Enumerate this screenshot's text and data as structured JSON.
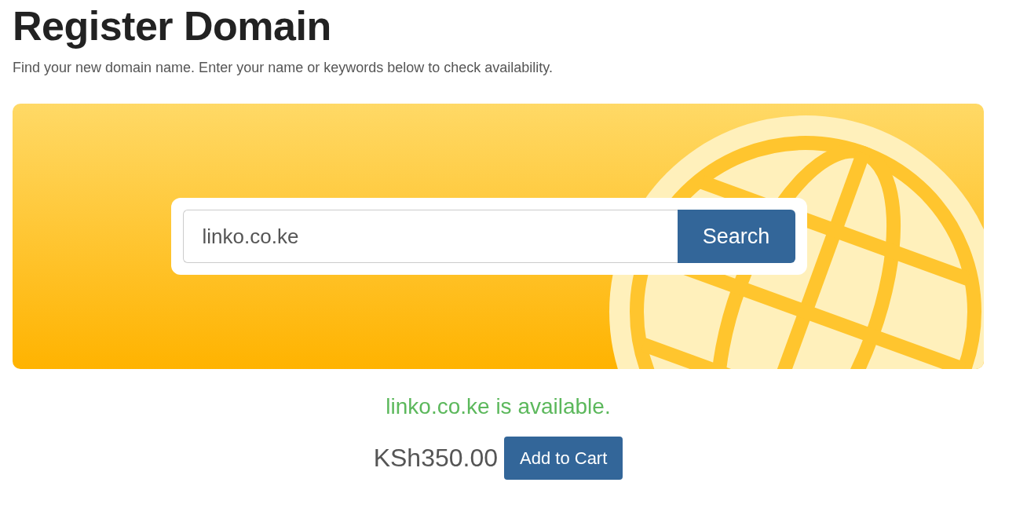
{
  "title": "Register Domain",
  "subtitle": "Find your new domain name. Enter your name or keywords below to check availability.",
  "search": {
    "value": "linko.co.ke",
    "button": "Search"
  },
  "result": {
    "message": "linko.co.ke is available.",
    "price": "KSh350.00",
    "button": "Add to Cart"
  }
}
